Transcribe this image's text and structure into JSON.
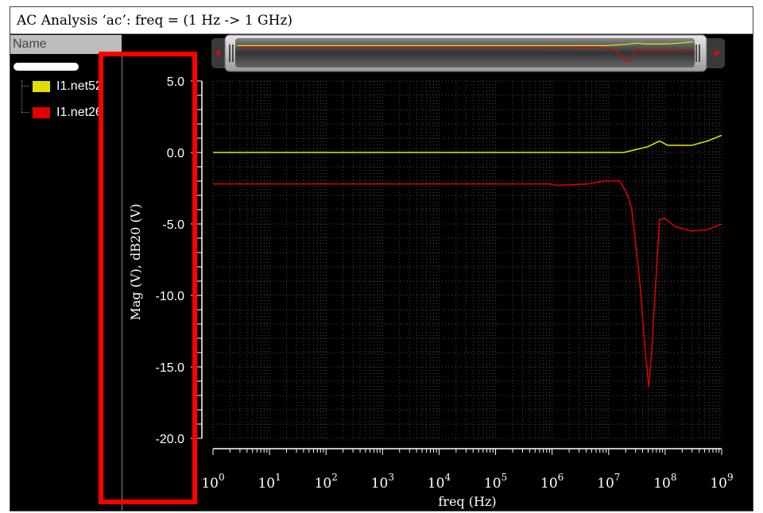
{
  "window": {
    "title": "AC Analysis ‘ac’: freq = (1 Hz -> 1 GHz)"
  },
  "panel": {
    "header": "Name",
    "signals": [
      {
        "label": "I1.net52",
        "color": "#e0e000"
      },
      {
        "label": "I1.net26",
        "color": "#e00000"
      }
    ]
  },
  "chart_data": {
    "type": "line",
    "title": "AC Analysis 'ac': freq = (1 Hz -> 1 GHz)",
    "xlabel": "freq (Hz)",
    "ylabel": "Mag (V), dB20 (V)",
    "x_scale": "log10",
    "xlim_log10": [
      0,
      9
    ],
    "ylim": [
      -20,
      5
    ],
    "grid": true,
    "x_ticks": [
      {
        "base": "10",
        "exp": "0"
      },
      {
        "base": "10",
        "exp": "1"
      },
      {
        "base": "10",
        "exp": "2"
      },
      {
        "base": "10",
        "exp": "3"
      },
      {
        "base": "10",
        "exp": "4"
      },
      {
        "base": "10",
        "exp": "5"
      },
      {
        "base": "10",
        "exp": "6"
      },
      {
        "base": "10",
        "exp": "7"
      },
      {
        "base": "10",
        "exp": "8"
      },
      {
        "base": "10",
        "exp": "9"
      }
    ],
    "y_ticks": [
      "5.0",
      "0.0",
      "-5.0",
      "-10.0",
      "-15.0",
      "-20.0"
    ],
    "y_tick_values": [
      5,
      0,
      -5,
      -10,
      -15,
      -20
    ],
    "series": [
      {
        "name": "I1.net52",
        "color": "#e8e800",
        "log10_freq": [
          0,
          7.27,
          7.48,
          7.69,
          7.9,
          8.05,
          8.47,
          8.75,
          9.0
        ],
        "db": [
          0,
          0,
          0.2,
          0.4,
          0.8,
          0.5,
          0.5,
          0.8,
          1.2
        ]
      },
      {
        "name": "I1.net26",
        "color": "#e00000",
        "log10_freq": [
          0,
          5.94,
          6.08,
          6.64,
          6.92,
          7.2,
          7.34,
          7.41,
          7.55,
          7.65,
          7.71,
          7.76,
          7.85,
          7.9,
          7.99,
          8.18,
          8.47,
          8.75,
          9.0
        ],
        "db": [
          -2.2,
          -2.2,
          -2.3,
          -2.2,
          -2.0,
          -2.0,
          -3.0,
          -4.0,
          -9.0,
          -14.0,
          -16.4,
          -14.0,
          -8.0,
          -4.7,
          -4.6,
          -5.2,
          -5.5,
          -5.4,
          -5.0
        ]
      }
    ]
  }
}
